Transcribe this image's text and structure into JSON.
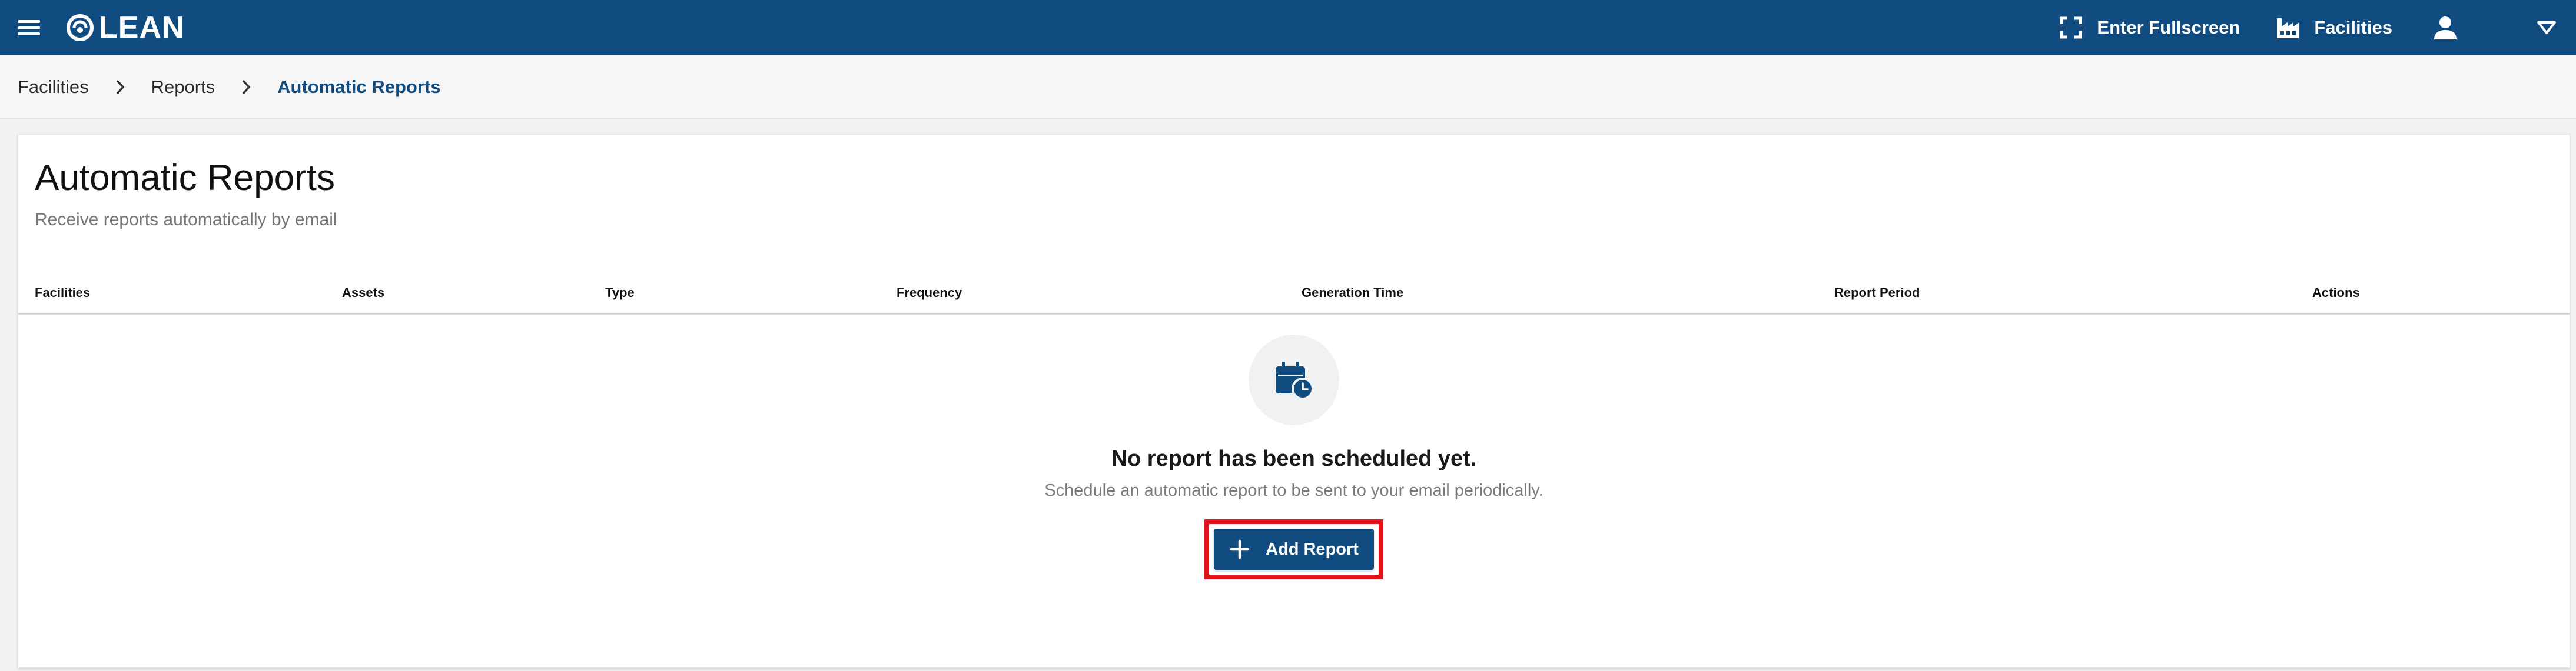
{
  "app": {
    "brand": "LEAN"
  },
  "topbar": {
    "fullscreen_label": "Enter Fullscreen",
    "facilities_label": "Facilities",
    "icons": [
      "menu-icon",
      "lean-logo-icon",
      "fullscreen-icon",
      "factory-icon",
      "user-icon",
      "caret-down-icon"
    ]
  },
  "breadcrumb": {
    "items": [
      "Facilities",
      "Reports",
      "Automatic Reports"
    ]
  },
  "page": {
    "title": "Automatic Reports",
    "subtitle": "Receive reports automatically by email"
  },
  "table": {
    "columns": [
      "Facilities",
      "Assets",
      "Type",
      "Frequency",
      "Generation Time",
      "Report Period",
      "Actions"
    ],
    "rows": []
  },
  "empty_state": {
    "icon": "calendar-clock-icon",
    "title": "No report has been scheduled yet.",
    "description": "Schedule an automatic report to be sent to your email periodically.",
    "button_label": "Add Report"
  },
  "colors": {
    "primary": "#114c81",
    "highlight": "#e2121b",
    "background": "#f2f2f2"
  }
}
